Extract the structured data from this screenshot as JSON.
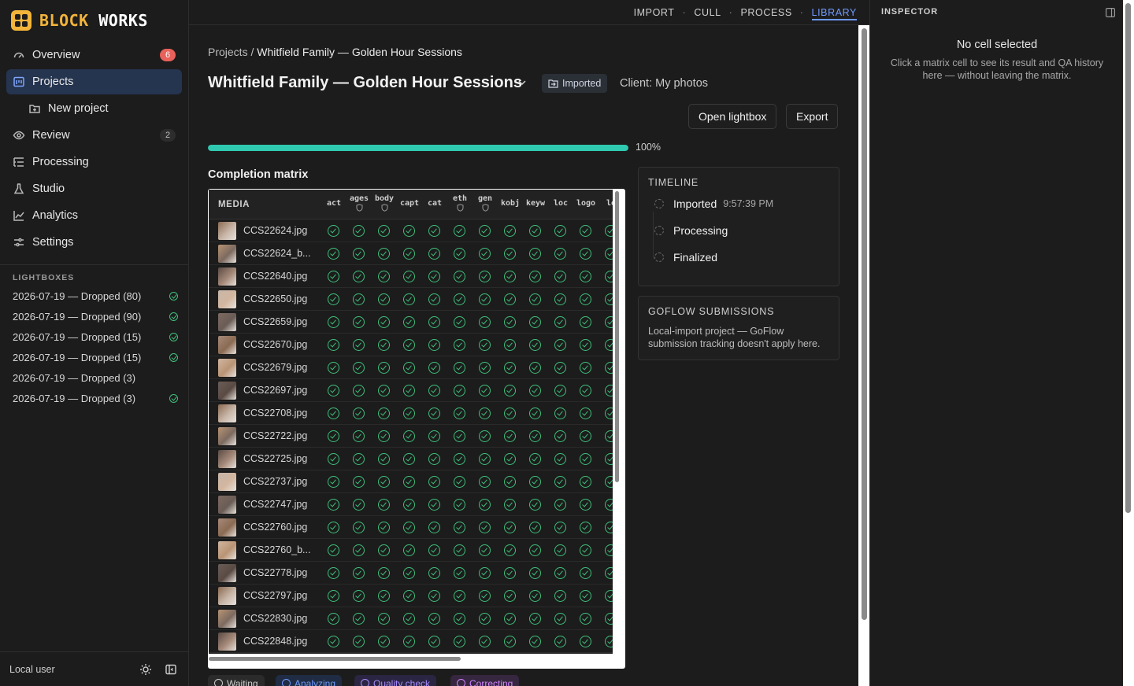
{
  "brand": {
    "part1": "BLOCK",
    "part2": "WORKS",
    "accent": "#f2b43a"
  },
  "sidebar": {
    "items": [
      {
        "label": "Overview",
        "icon": "gauge-icon",
        "badge": "6"
      },
      {
        "label": "Projects",
        "icon": "projects-icon",
        "active": true
      },
      {
        "label": "New project",
        "icon": "folder-plus-icon"
      },
      {
        "label": "Review",
        "icon": "eye-icon",
        "badge": "2"
      },
      {
        "label": "Processing",
        "icon": "list-tree-icon"
      },
      {
        "label": "Studio",
        "icon": "flask-icon"
      },
      {
        "label": "Analytics",
        "icon": "chart-line-icon"
      },
      {
        "label": "Settings",
        "icon": "sliders-icon"
      }
    ],
    "lightboxes_heading": "LIGHTBOXES",
    "lightboxes": [
      {
        "label": "2026-07-19 — Dropped (80)",
        "done": true
      },
      {
        "label": "2026-07-19 — Dropped (90)",
        "done": true
      },
      {
        "label": "2026-07-19 — Dropped (15)",
        "done": true
      },
      {
        "label": "2026-07-19 — Dropped (15)",
        "done": true
      },
      {
        "label": "2026-07-19 — Dropped (3)",
        "done": false
      },
      {
        "label": "2026-07-19 — Dropped (3)",
        "done": true
      }
    ],
    "footer_user": "Local user"
  },
  "topnav": {
    "import": "IMPORT",
    "cull": "CULL",
    "process": "PROCESS",
    "library": "LIBRARY",
    "sep": "·"
  },
  "main": {
    "breadcrumb_root": "Projects",
    "breadcrumb_sep": " / ",
    "breadcrumb_current": "Whitfield Family — Golden Hour Sessions",
    "title": "Whitfield Family — Golden Hour Sessions",
    "status_badge": "Imported",
    "client": "Client: My photos",
    "open_lightbox": "Open lightbox",
    "export": "Export",
    "progress": 1.0,
    "progress_label": "100%",
    "matrix_heading": "Completion matrix",
    "media_header": "MEDIA",
    "columns": [
      {
        "label": "act",
        "shield": false
      },
      {
        "label": "ages",
        "shield": true
      },
      {
        "label": "body",
        "shield": true
      },
      {
        "label": "capt",
        "shield": false
      },
      {
        "label": "cat",
        "shield": false
      },
      {
        "label": "eth",
        "shield": true
      },
      {
        "label": "gen",
        "shield": true
      },
      {
        "label": "kobj",
        "shield": false
      },
      {
        "label": "keyw",
        "shield": false
      },
      {
        "label": "loc",
        "shield": false
      },
      {
        "label": "logo",
        "shield": false
      },
      {
        "label": "lo",
        "shield": false
      }
    ],
    "rows": [
      "CCS22624.jpg",
      "CCS22624_b...",
      "CCS22640.jpg",
      "CCS22650.jpg",
      "CCS22659.jpg",
      "CCS22670.jpg",
      "CCS22679.jpg",
      "CCS22697.jpg",
      "CCS22708.jpg",
      "CCS22722.jpg",
      "CCS22725.jpg",
      "CCS22737.jpg",
      "CCS22747.jpg",
      "CCS22760.jpg",
      "CCS22760_b...",
      "CCS22778.jpg",
      "CCS22797.jpg",
      "CCS22830.jpg",
      "CCS22848.jpg"
    ],
    "legend": [
      {
        "label": "Waiting",
        "color": "#cfcfcf",
        "bg": "#2b2b2b"
      },
      {
        "label": "Analyzing",
        "color": "#6f9bff",
        "bg": "#1f2c44"
      },
      {
        "label": "Quality check",
        "color": "#a88bff",
        "bg": "#2a2542"
      },
      {
        "label": "Correcting",
        "color": "#d184ff",
        "bg": "#36263f"
      }
    ]
  },
  "timeline": {
    "heading": "TIMELINE",
    "events": [
      {
        "label": "Imported",
        "time": "9:57:39 PM"
      },
      {
        "label": "Processing",
        "time": ""
      },
      {
        "label": "Finalized",
        "time": ""
      }
    ]
  },
  "goflow": {
    "heading": "GOFLOW SUBMISSIONS",
    "text": "Local-import project — GoFlow submission tracking doesn't apply here."
  },
  "inspector": {
    "heading": "INSPECTOR",
    "title": "No cell selected",
    "desc": "Click a matrix cell to see its result and QA history here — without leaving the matrix."
  }
}
